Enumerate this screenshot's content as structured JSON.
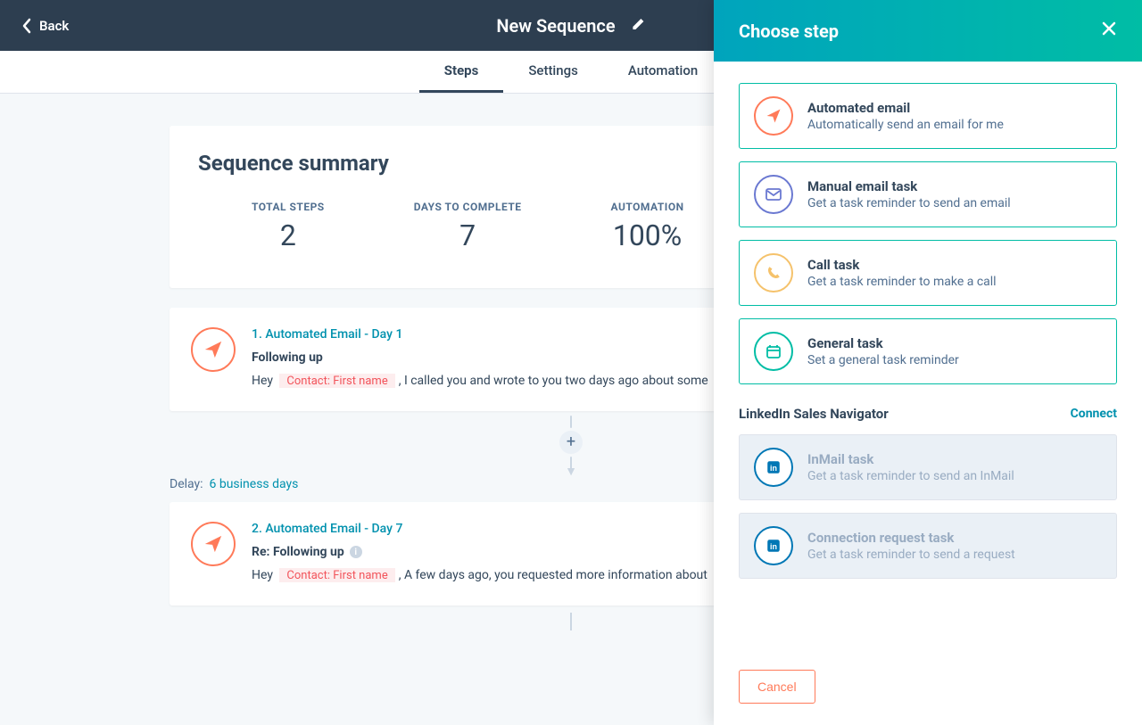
{
  "header": {
    "back_label": "Back",
    "title": "New Sequence"
  },
  "tabs": [
    {
      "label": "Steps",
      "active": true
    },
    {
      "label": "Settings",
      "active": false
    },
    {
      "label": "Automation",
      "active": false
    }
  ],
  "summary": {
    "title": "Sequence summary",
    "stats": [
      {
        "label": "TOTAL STEPS",
        "value": "2"
      },
      {
        "label": "DAYS TO COMPLETE",
        "value": "7"
      },
      {
        "label": "AUTOMATION",
        "value": "100%"
      }
    ]
  },
  "steps": [
    {
      "heading": "1. Automated Email - Day 1",
      "subject": "Following up",
      "has_info": false,
      "pre": "Hey ",
      "token": "Contact: First name",
      "post": ", I called you and wrote to you two days ago about some"
    },
    {
      "heading": "2. Automated Email - Day 7",
      "subject": "Re: Following up",
      "has_info": true,
      "pre": "Hey ",
      "token": "Contact: First name",
      "post": ", A few days ago, you requested more information about"
    }
  ],
  "delay": {
    "label": "Delay:",
    "value": "6 business days"
  },
  "panel": {
    "title": "Choose step",
    "options_primary": [
      {
        "icon": "paper-plane",
        "color": "orange",
        "title": "Automated email",
        "desc": "Automatically send an email for me"
      },
      {
        "icon": "envelope",
        "color": "purple",
        "title": "Manual email task",
        "desc": "Get a task reminder to send an email"
      },
      {
        "icon": "phone",
        "color": "gold",
        "title": "Call task",
        "desc": "Get a task reminder to make a call"
      },
      {
        "icon": "calendar",
        "color": "teal",
        "title": "General task",
        "desc": "Set a general task reminder"
      }
    ],
    "linkedin": {
      "heading": "LinkedIn Sales Navigator",
      "connect_label": "Connect",
      "options": [
        {
          "title": "InMail task",
          "desc": "Get a task reminder to send an InMail"
        },
        {
          "title": "Connection request task",
          "desc": "Get a task reminder to send a request"
        }
      ]
    },
    "cancel_label": "Cancel"
  }
}
